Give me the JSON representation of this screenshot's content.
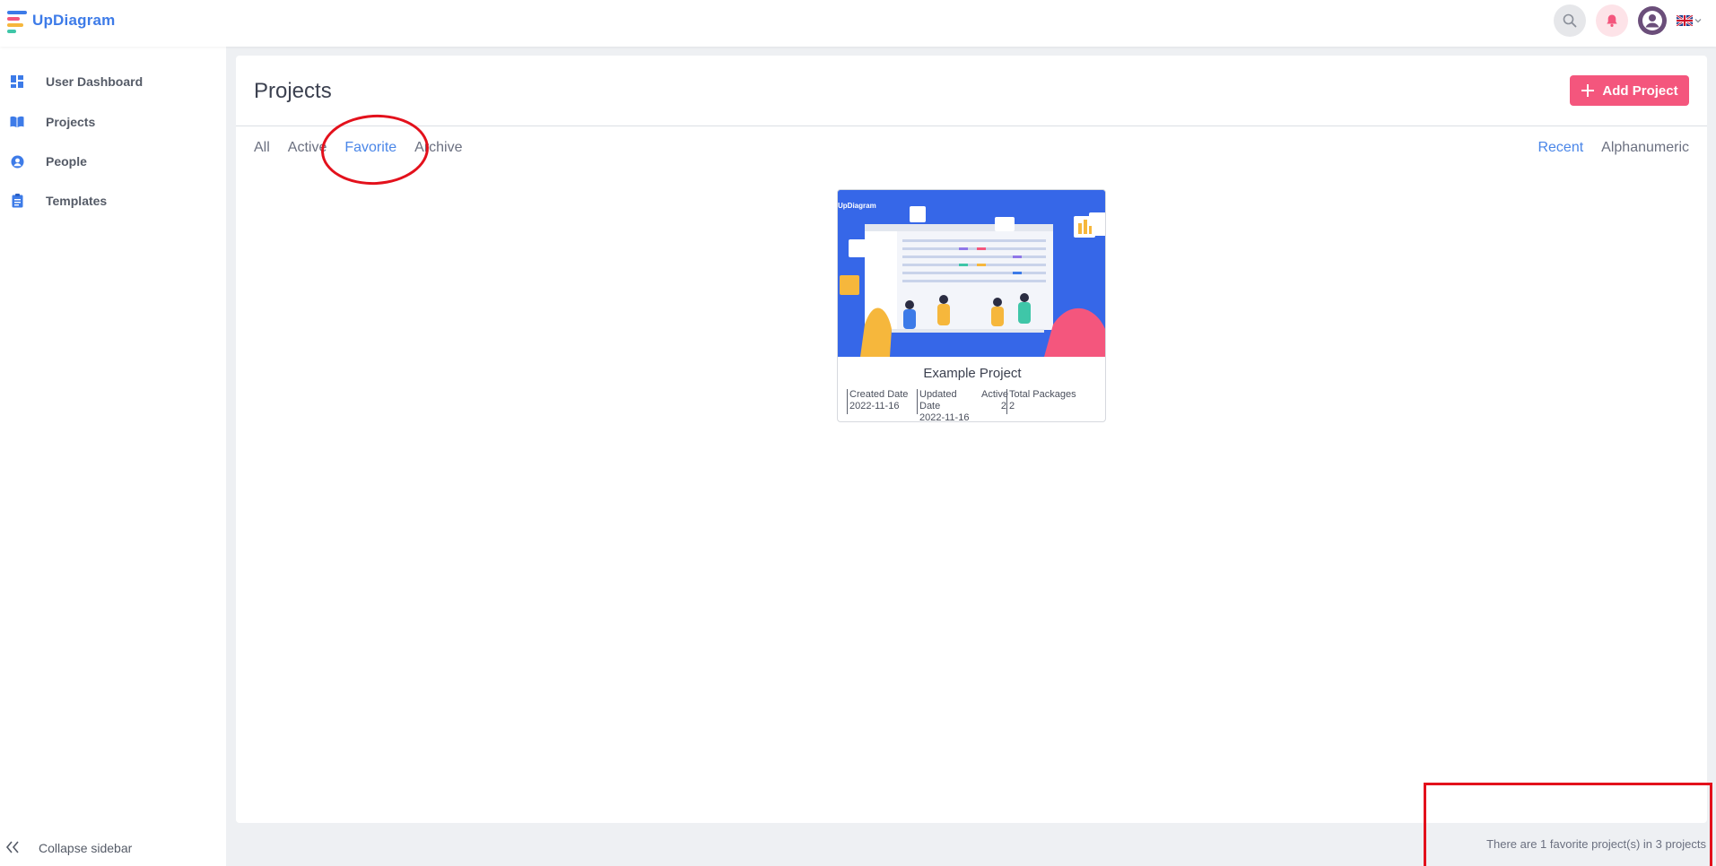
{
  "app": {
    "logo_text": "UpDiagram"
  },
  "sidebar": {
    "items": [
      {
        "label": "User Dashboard",
        "icon": "dashboard-icon"
      },
      {
        "label": "Projects",
        "icon": "book-icon"
      },
      {
        "label": "People",
        "icon": "person-icon"
      },
      {
        "label": "Templates",
        "icon": "clipboard-icon"
      }
    ],
    "collapse_label": "Collapse sidebar"
  },
  "main": {
    "title": "Projects",
    "add_button_label": "Add Project",
    "tabs": [
      {
        "label": "All",
        "active": false
      },
      {
        "label": "Active",
        "active": false
      },
      {
        "label": "Favorite",
        "active": true
      },
      {
        "label": "Archive",
        "active": false
      }
    ],
    "sort_options": [
      {
        "label": "Recent",
        "active": true
      },
      {
        "label": "Alphanumeric",
        "active": false
      }
    ]
  },
  "project": {
    "name": "Example Project",
    "thumbnail_brand": "UpDiagram",
    "created_label": "Created Date",
    "created_value": "2022-11-16",
    "updated_label": "Updated Date",
    "updated_value": "2022-11-16",
    "active_label": "Active",
    "active_value": "2",
    "packages_label": "Total Packages",
    "packages_value": "2"
  },
  "footer": {
    "summary": "There are 1 favorite project(s) in 3 projects"
  },
  "colors": {
    "accent": "#4a86e8",
    "brand_pink": "#f4567d",
    "annotation_red": "#e3111c"
  }
}
